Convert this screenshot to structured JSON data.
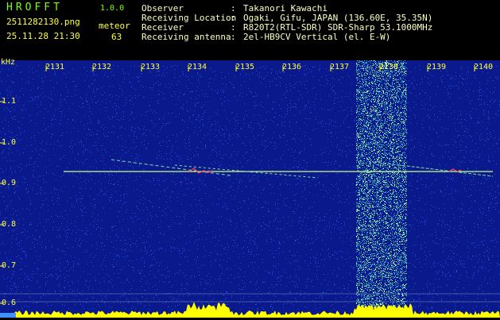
{
  "header": {
    "app_name": "HROFFT",
    "version": "1.0.0",
    "filename": "2511282130.png",
    "timestamp": "25.11.28 21:30",
    "meteor_label": "meteor",
    "meteor_count": "63",
    "info_rows": [
      {
        "label": "Observer",
        "value": "Takanori Kawachi"
      },
      {
        "label": "Receiving Location",
        "value": "Ogaki, Gifu, JAPAN (136.60E, 35.35N)"
      },
      {
        "label": "Receiver",
        "value": "R820T2(RTL-SDR) SDR-Sharp 53.1000MHz"
      },
      {
        "label": "Receiving antenna",
        "value": "2el-HB9CV Vertical (el. E-W)"
      }
    ]
  },
  "chart_data": {
    "type": "heatmap",
    "ylabel": "kHz",
    "x_tick_labels": [
      "2131",
      "2132",
      "2133",
      "2134",
      "2135",
      "2136",
      "2137",
      "2138",
      "2139",
      "2140"
    ],
    "y_tick_labels": [
      "1.1",
      "1.0",
      "0.9",
      "0.8",
      "0.7",
      "0.6"
    ],
    "colors": {
      "background": "#0a1a8c",
      "noise": "#2a60ff",
      "band": "#40d0c0",
      "signal": "#ffff00",
      "trace": "#d0ff80"
    }
  }
}
